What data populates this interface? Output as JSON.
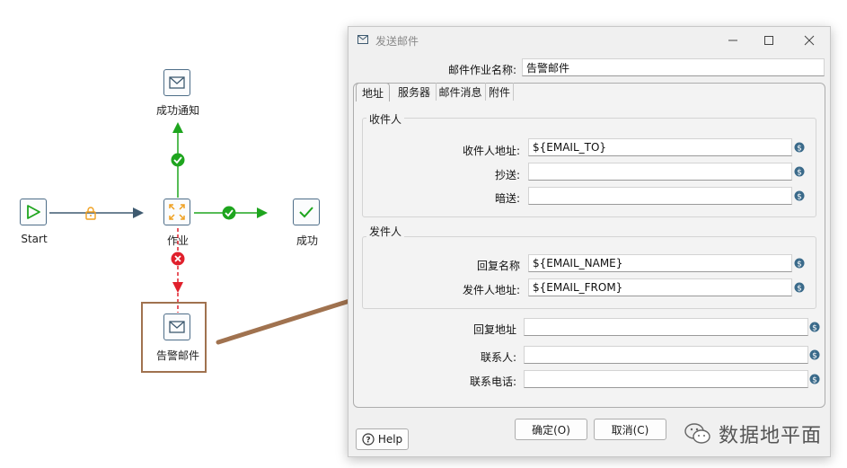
{
  "canvas": {
    "nodes": {
      "start": "Start",
      "job": "作业",
      "success": "成功",
      "success_notify": "成功通知",
      "alert_mail": "告警邮件"
    }
  },
  "dialog": {
    "title": "发送邮件",
    "job_name_label": "邮件作业名称:",
    "job_name_value": "告警邮件",
    "tabs": [
      "地址",
      "服务器",
      "邮件消息",
      "附件"
    ],
    "recipient_group": "收件人",
    "recipient_address_label": "收件人地址:",
    "recipient_address_value": "${EMAIL_TO}",
    "cc_label": "抄送:",
    "cc_value": "",
    "bcc_label": "暗送:",
    "bcc_value": "",
    "sender_group": "发件人",
    "reply_name_label": "回复名称",
    "reply_name_value": "${EMAIL_NAME}",
    "sender_address_label": "发件人地址:",
    "sender_address_value": "${EMAIL_FROM}",
    "reply_address_label": "回复地址",
    "reply_address_value": "",
    "contact_label": "联系人:",
    "contact_value": "",
    "contact_phone_label": "联系电话:",
    "contact_phone_value": "",
    "ok_button": "确定(O)",
    "cancel_button": "取消(C)",
    "help_button": "Help"
  },
  "watermark": "数据地平面",
  "colors": {
    "success_green": "#1ea51e",
    "error_red": "#e0202c",
    "hop_blue": "#3e5a70",
    "lock_orange": "#f0a020",
    "annotation_brown": "#a0724f",
    "variable_icon": "#3a6a8a"
  }
}
